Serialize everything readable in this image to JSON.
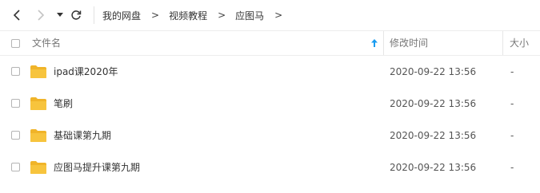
{
  "toolbar": {
    "breadcrumb": [
      "我的网盘",
      "视频教程",
      "应图马"
    ],
    "separator": ">"
  },
  "header": {
    "name_label": "文件名",
    "modified_label": "修改时间",
    "size_label": "大小",
    "sort_direction": "ascending"
  },
  "files": [
    {
      "name": "ipad课2020年",
      "modified": "2020-09-22 13:56",
      "size": "-"
    },
    {
      "name": "笔刷",
      "modified": "2020-09-22 13:56",
      "size": "-"
    },
    {
      "name": "基础课第九期",
      "modified": "2020-09-22 13:56",
      "size": "-"
    },
    {
      "name": "应图马提升课第九期",
      "modified": "2020-09-22 13:56",
      "size": "-"
    }
  ],
  "colors": {
    "folder": "#f7c43d",
    "folder_tab": "#f0b429",
    "sort_arrow": "#1a9cf0"
  }
}
